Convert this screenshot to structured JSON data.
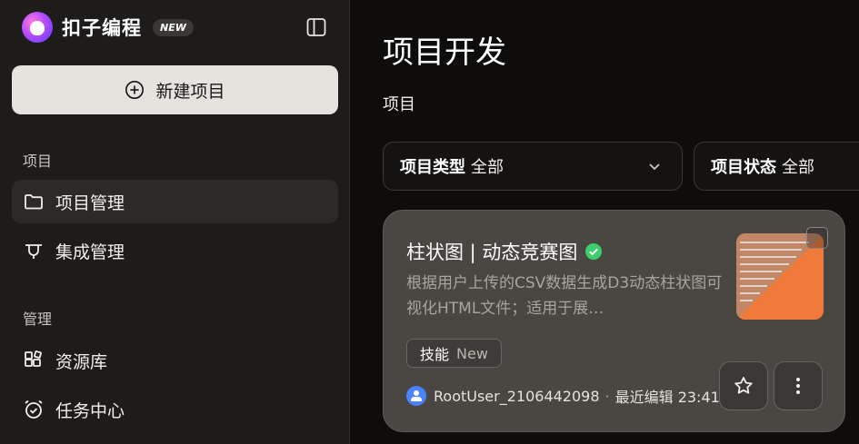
{
  "brand": {
    "name": "扣子编程",
    "badge": "NEW"
  },
  "sidebar": {
    "new_project_label": "新建项目",
    "sections": [
      {
        "label": "项目",
        "items": [
          {
            "label": "项目管理",
            "icon": "folder-icon",
            "active": true
          },
          {
            "label": "集成管理",
            "icon": "integration-icon",
            "active": false
          }
        ]
      },
      {
        "label": "管理",
        "items": [
          {
            "label": "资源库",
            "icon": "resource-library-icon",
            "active": false
          },
          {
            "label": "任务中心",
            "icon": "alarm-clock-icon",
            "active": false
          }
        ]
      }
    ]
  },
  "main": {
    "title": "项目开发",
    "sub_tab": "项目",
    "filters": [
      {
        "label": "项目类型",
        "value": "全部"
      },
      {
        "label": "项目状态",
        "value": "全部"
      }
    ],
    "card": {
      "title": "柱状图 | 动态竞赛图",
      "description": "根据用户上传的CSV数据生成D3动态柱状图可视化HTML文件；适用于展…",
      "tag_main": "技能",
      "tag_extra": "New",
      "user": "RootUser_2106442098",
      "edited": "最近编辑 23:41",
      "dot": "·"
    }
  },
  "colors": {
    "accent": "#4b82ff",
    "thumb": "#f07a3b",
    "verified": "#3ccf6e"
  }
}
